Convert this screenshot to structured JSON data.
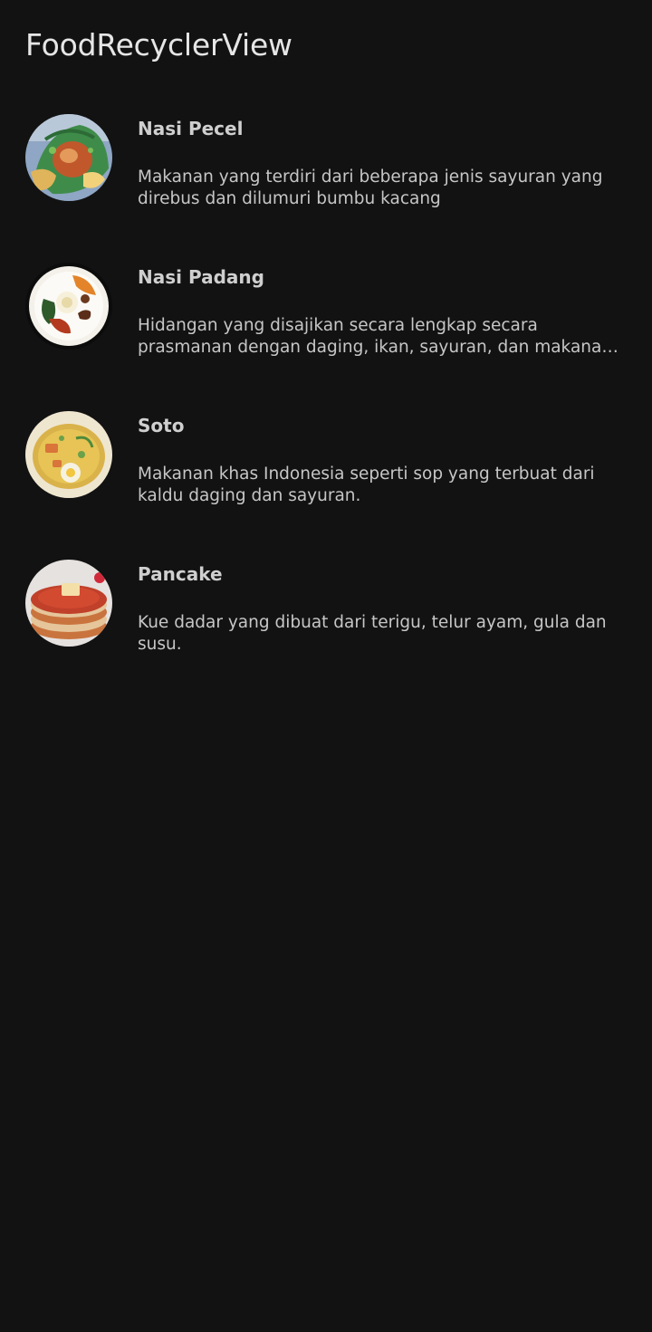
{
  "app": {
    "title": "FoodRecyclerView"
  },
  "foods": [
    {
      "name": "Nasi Pecel",
      "description": "Makanan yang terdiri dari beberapa jenis sayuran yang direbus dan dilumuri bumbu kacang",
      "icon": "nasi-pecel-photo"
    },
    {
      "name": "Nasi Padang",
      "description": "Hidangan yang disajikan secara lengkap secara prasmanan dengan daging, ikan, sayuran, dan makanan pedas dimakan ...",
      "icon": "nasi-padang-photo"
    },
    {
      "name": "Soto",
      "description": "Makanan khas Indonesia seperti sop yang terbuat dari kaldu daging dan sayuran.",
      "icon": "soto-photo"
    },
    {
      "name": "Pancake",
      "description": "Kue dadar yang dibuat dari terigu, telur ayam, gula dan susu.",
      "icon": "pancake-photo"
    }
  ],
  "colors": {
    "background": "#121212",
    "title_text": "#e6e6e6",
    "name_text": "#cfcfcf",
    "description_text": "#c6c6c6"
  }
}
